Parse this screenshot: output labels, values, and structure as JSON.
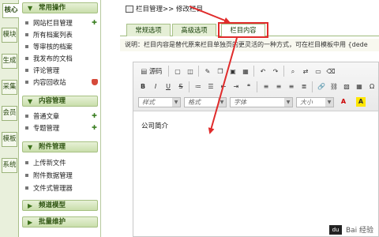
{
  "vertical_tabs": [
    {
      "label": "核心"
    },
    {
      "label": "模块"
    },
    {
      "label": "生成"
    },
    {
      "label": "采集"
    },
    {
      "label": "会员"
    },
    {
      "label": "模板"
    },
    {
      "label": "系统"
    }
  ],
  "menu": {
    "sections": [
      {
        "title": "常用操作",
        "items": [
          "网站栏目管理",
          "所有档案列表",
          "等审核的档案",
          "我发布的文档",
          "评论管理",
          "内容回收站"
        ]
      },
      {
        "title": "内容管理",
        "items": [
          "普通文章",
          "专题管理"
        ]
      },
      {
        "title": "附件管理",
        "items": [
          "上传新文件",
          "附件数据管理",
          "文件式管理器"
        ]
      },
      {
        "title": "频道模型",
        "items": []
      },
      {
        "title": "批量维护",
        "items": []
      }
    ]
  },
  "breadcrumb": {
    "text": "栏目管理>> 修改栏目"
  },
  "tabs": [
    {
      "label": "常规选项"
    },
    {
      "label": "高级选项"
    },
    {
      "label": "栏目内容"
    }
  ],
  "description": "说明：栏目内容是替代原来栏目单独页的更灵活的一种方式，可在栏目模板中用 {dede",
  "editor": {
    "source_label": "源码",
    "toolbar_row2": [
      "B",
      "I",
      "U",
      "S"
    ],
    "selects": [
      {
        "label": "样式"
      },
      {
        "label": "格式"
      },
      {
        "label": "字体"
      },
      {
        "label": "大小"
      }
    ],
    "content": "公司简介"
  },
  "annotation_color": "#e02b2b",
  "watermark": "Bai 经验"
}
